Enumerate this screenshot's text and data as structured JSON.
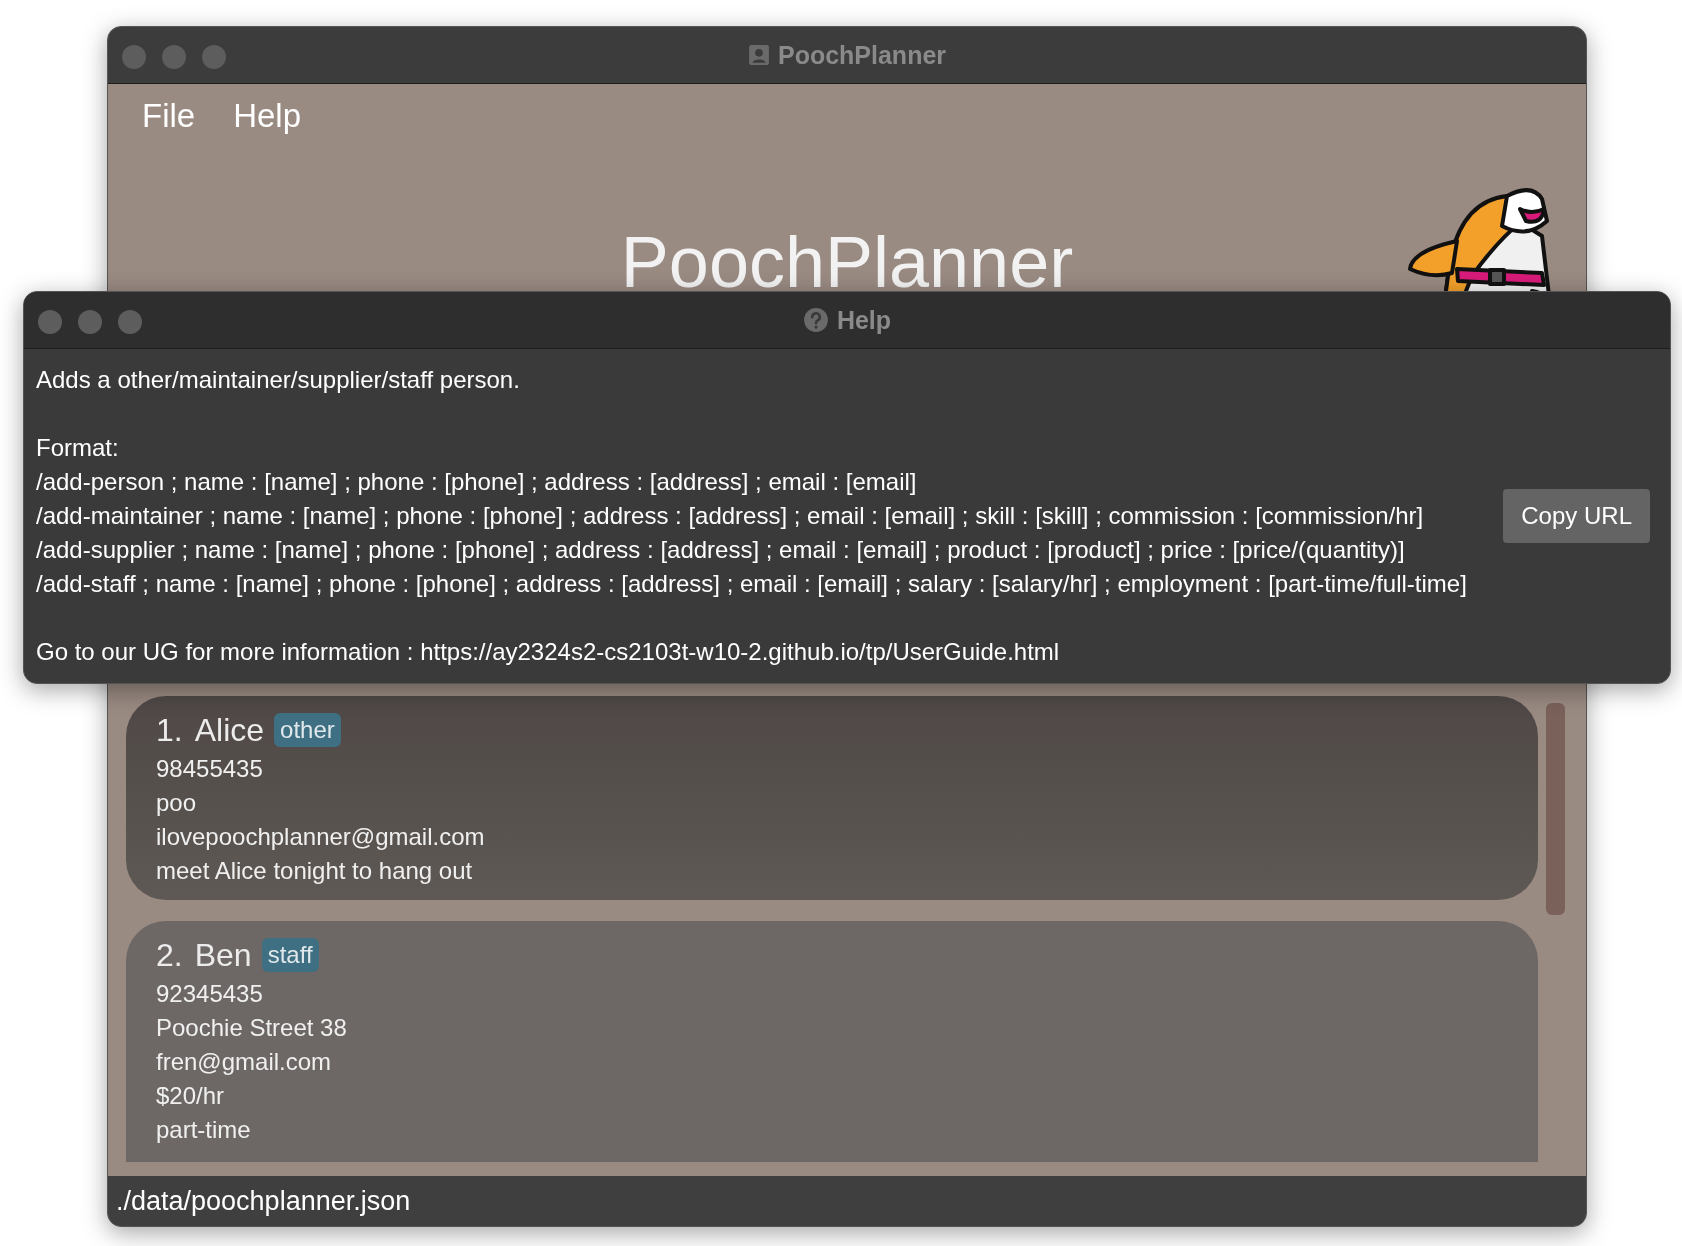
{
  "main_window": {
    "title": "PoochPlanner",
    "menu": [
      {
        "label": "File"
      },
      {
        "label": "Help"
      }
    ],
    "heading": "PoochPlanner",
    "cards": [
      {
        "index": "1.",
        "name": "Alice",
        "tag": "other",
        "selected": true,
        "lines": [
          "98455435",
          "poo",
          "ilovepoochplanner@gmail.com",
          "meet Alice tonight to hang out"
        ]
      },
      {
        "index": "2.",
        "name": "Ben",
        "tag": "staff",
        "selected": false,
        "lines": [
          "92345435",
          "Poochie Street 38",
          "fren@gmail.com",
          "$20/hr",
          "part-time"
        ]
      }
    ],
    "status_bar": "./data/poochplanner.json"
  },
  "help_window": {
    "title": "Help",
    "paragraphs": [
      [
        "Adds a other/maintainer/supplier/staff person."
      ],
      [
        "Format:",
        "/add-person ; name : [name] ; phone : [phone] ; address : [address] ; email : [email]",
        "/add-maintainer ; name : [name] ; phone : [phone] ; address : [address] ; email : [email] ; skill : [skill] ; commission : [commission/hr]",
        "/add-supplier ; name : [name] ; phone : [phone] ; address : [address] ; email : [email] ; product : [product] ; price : [price/(quantity)]",
        "/add-staff ; name : [name] ; phone : [phone] ; address : [address] ; email : [email] ; salary : [salary/hr] ; employment : [part-time/full-time]"
      ],
      [
        "Go to our UG for more information : https://ay2324s2-cs2103t-w10-2.github.io/tp/UserGuide.html"
      ]
    ],
    "button": "Copy URL"
  }
}
